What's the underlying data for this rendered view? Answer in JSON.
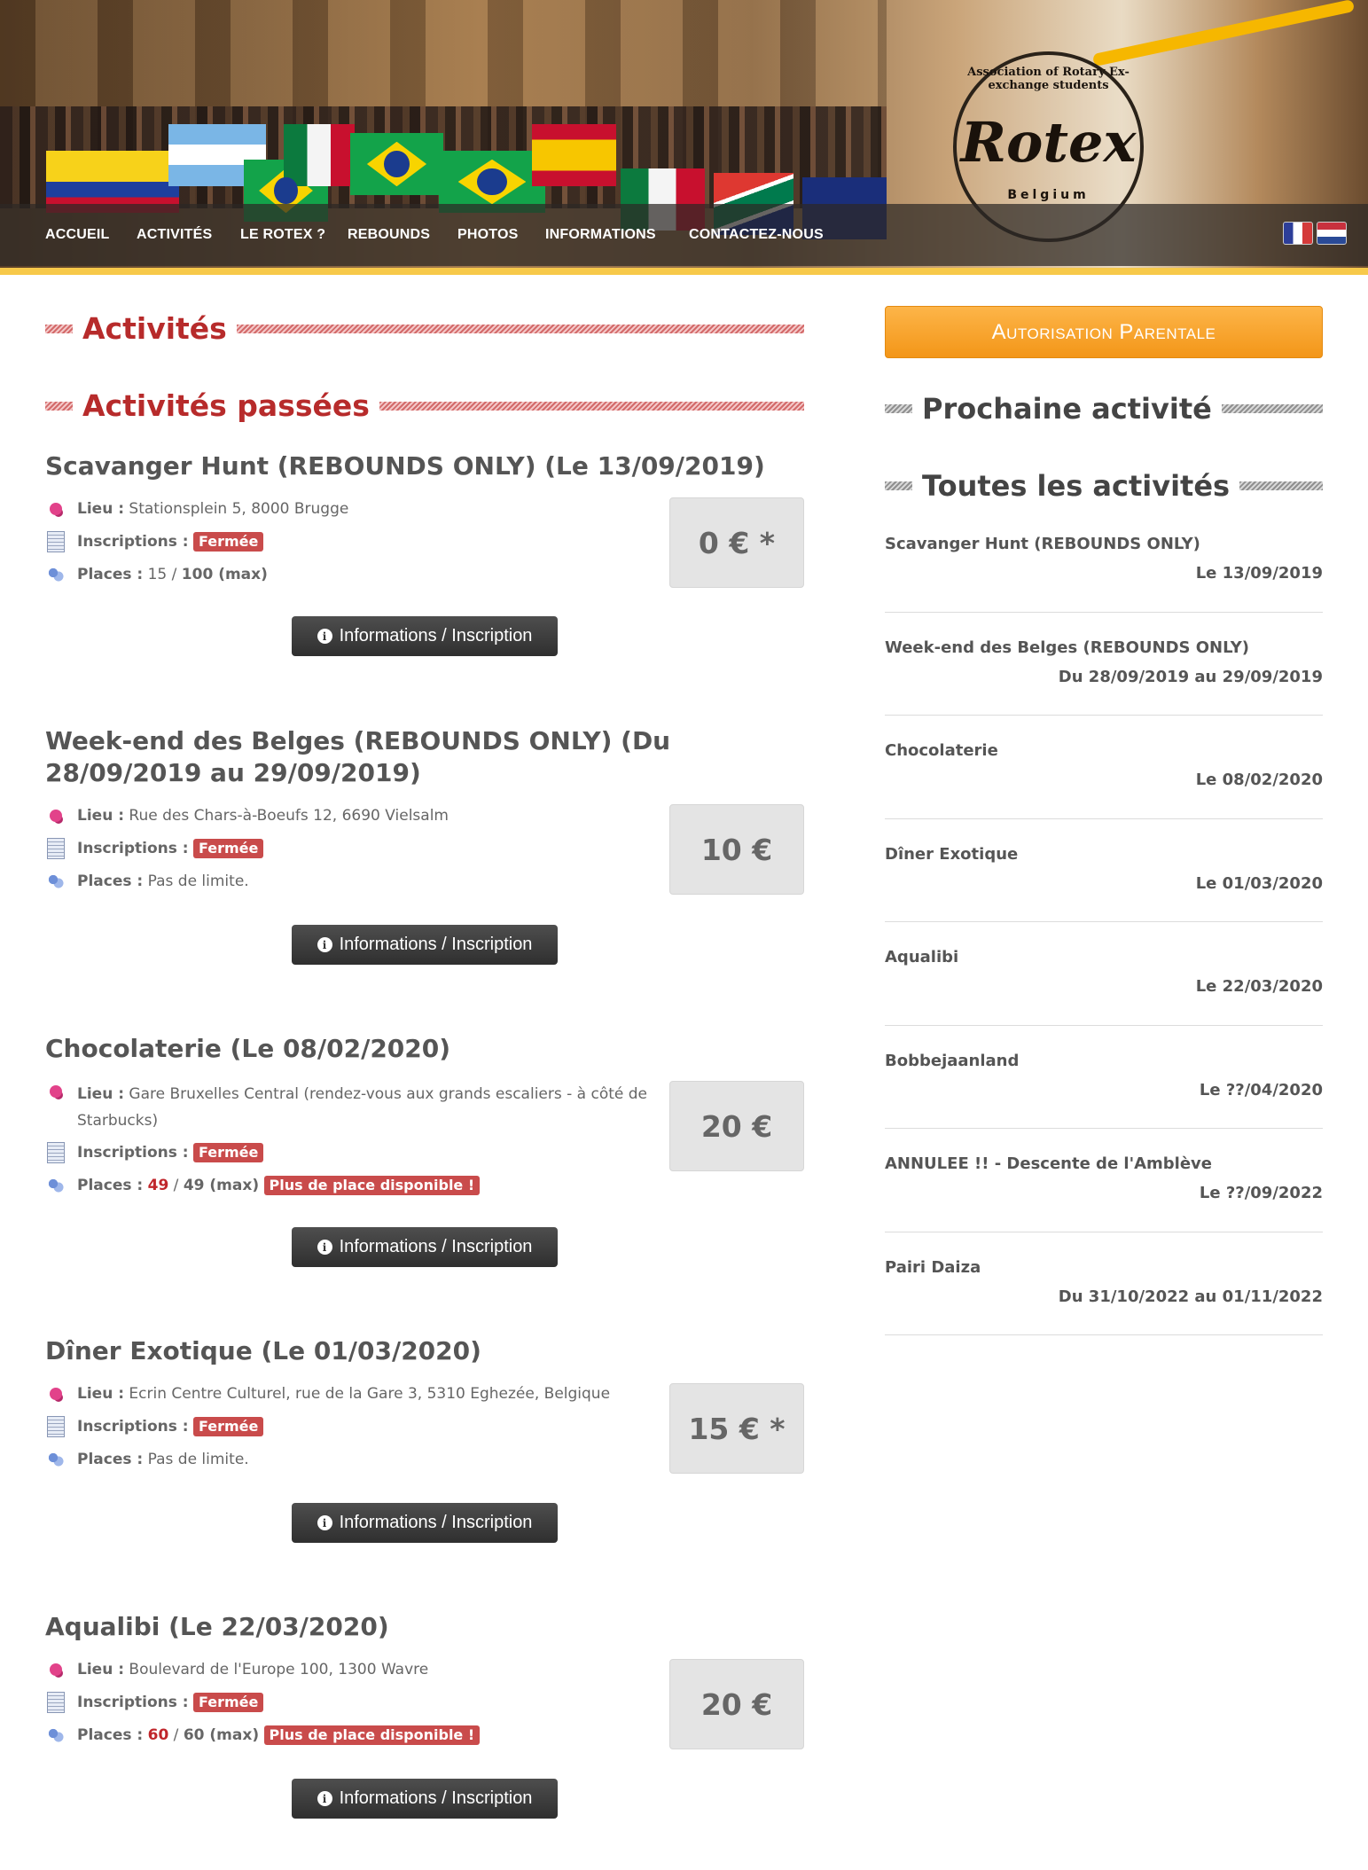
{
  "nav": {
    "items": [
      "Accueil",
      "Activités",
      "Le Rotex ?",
      "Rebounds",
      "Photos",
      "Informations",
      "Contactez-nous"
    ]
  },
  "logo": {
    "ring_text": "Association of Rotary Ex-exchange students",
    "name": "Rotex",
    "country": "Belgium"
  },
  "page": {
    "title": "Activités",
    "past_title": "Activités passées"
  },
  "labels": {
    "lieu": "Lieu :",
    "inscriptions": "Inscriptions :",
    "places": "Places :",
    "closed": "Fermée",
    "no_limit": "Pas de limite.",
    "full": "Plus de place disponible !",
    "max": "(max)",
    "button": "Informations / Inscription"
  },
  "activities": [
    {
      "title": "Scavanger Hunt (REBOUNDS ONLY) (Le 13/09/2019)",
      "lieu": "Stationsplein 5, 8000 Brugge",
      "places_taken": "15",
      "places_max": "100 (max)",
      "price": "0 € *"
    },
    {
      "title": "Week-end des Belges (REBOUNDS ONLY) (Du 28/09/2019 au 29/09/2019)",
      "lieu": "Rue des Chars-à-Boeufs 12, 6690 Vielsalm",
      "places_text": "Pas de limite.",
      "price": "10 €"
    },
    {
      "title": "Chocolaterie (Le 08/02/2020)",
      "lieu": "Gare Bruxelles Central (rendez-vous aux grands escaliers - à côté de Starbucks)",
      "places_taken": "49",
      "places_max": "49 (max)",
      "price": "20 €"
    },
    {
      "title": "Dîner Exotique (Le 01/03/2020)",
      "lieu": "Ecrin Centre Culturel, rue de la Gare 3, 5310 Eghezée, Belgique",
      "places_text": "Pas de limite.",
      "price": "15 € *"
    },
    {
      "title": "Aqualibi (Le 22/03/2020)",
      "lieu": "Boulevard de l'Europe 100, 1300 Wavre",
      "places_taken": "60",
      "places_max": "60 (max)",
      "price": "20 €"
    }
  ],
  "sidebar": {
    "auth_button": "Autorisation Parentale",
    "next_title": "Prochaine activité",
    "all_title": "Toutes les activités",
    "items": [
      {
        "name": "Scavanger Hunt (REBOUNDS ONLY)",
        "date": "Le 13/09/2019"
      },
      {
        "name": "Week-end des Belges (REBOUNDS ONLY)",
        "date": "Du 28/09/2019 au 29/09/2019"
      },
      {
        "name": "Chocolaterie",
        "date": "Le 08/02/2020"
      },
      {
        "name": "Dîner Exotique",
        "date": "Le 01/03/2020"
      },
      {
        "name": "Aqualibi",
        "date": "Le 22/03/2020"
      },
      {
        "name": "Bobbejaanland",
        "date": "Le ??/04/2020"
      },
      {
        "name": "ANNULEE !! - Descente de l'Amblève",
        "date": "Le ??/09/2022"
      },
      {
        "name": "Pairi Daiza",
        "date": "Du 31/10/2022 au 01/11/2022"
      }
    ]
  },
  "colors": {
    "title_red": "#b72b2b",
    "badge_red": "#c94b4b",
    "button_dark": "#3a3a3a",
    "orange": "#f39618",
    "header_accent": "#f7c94a"
  }
}
